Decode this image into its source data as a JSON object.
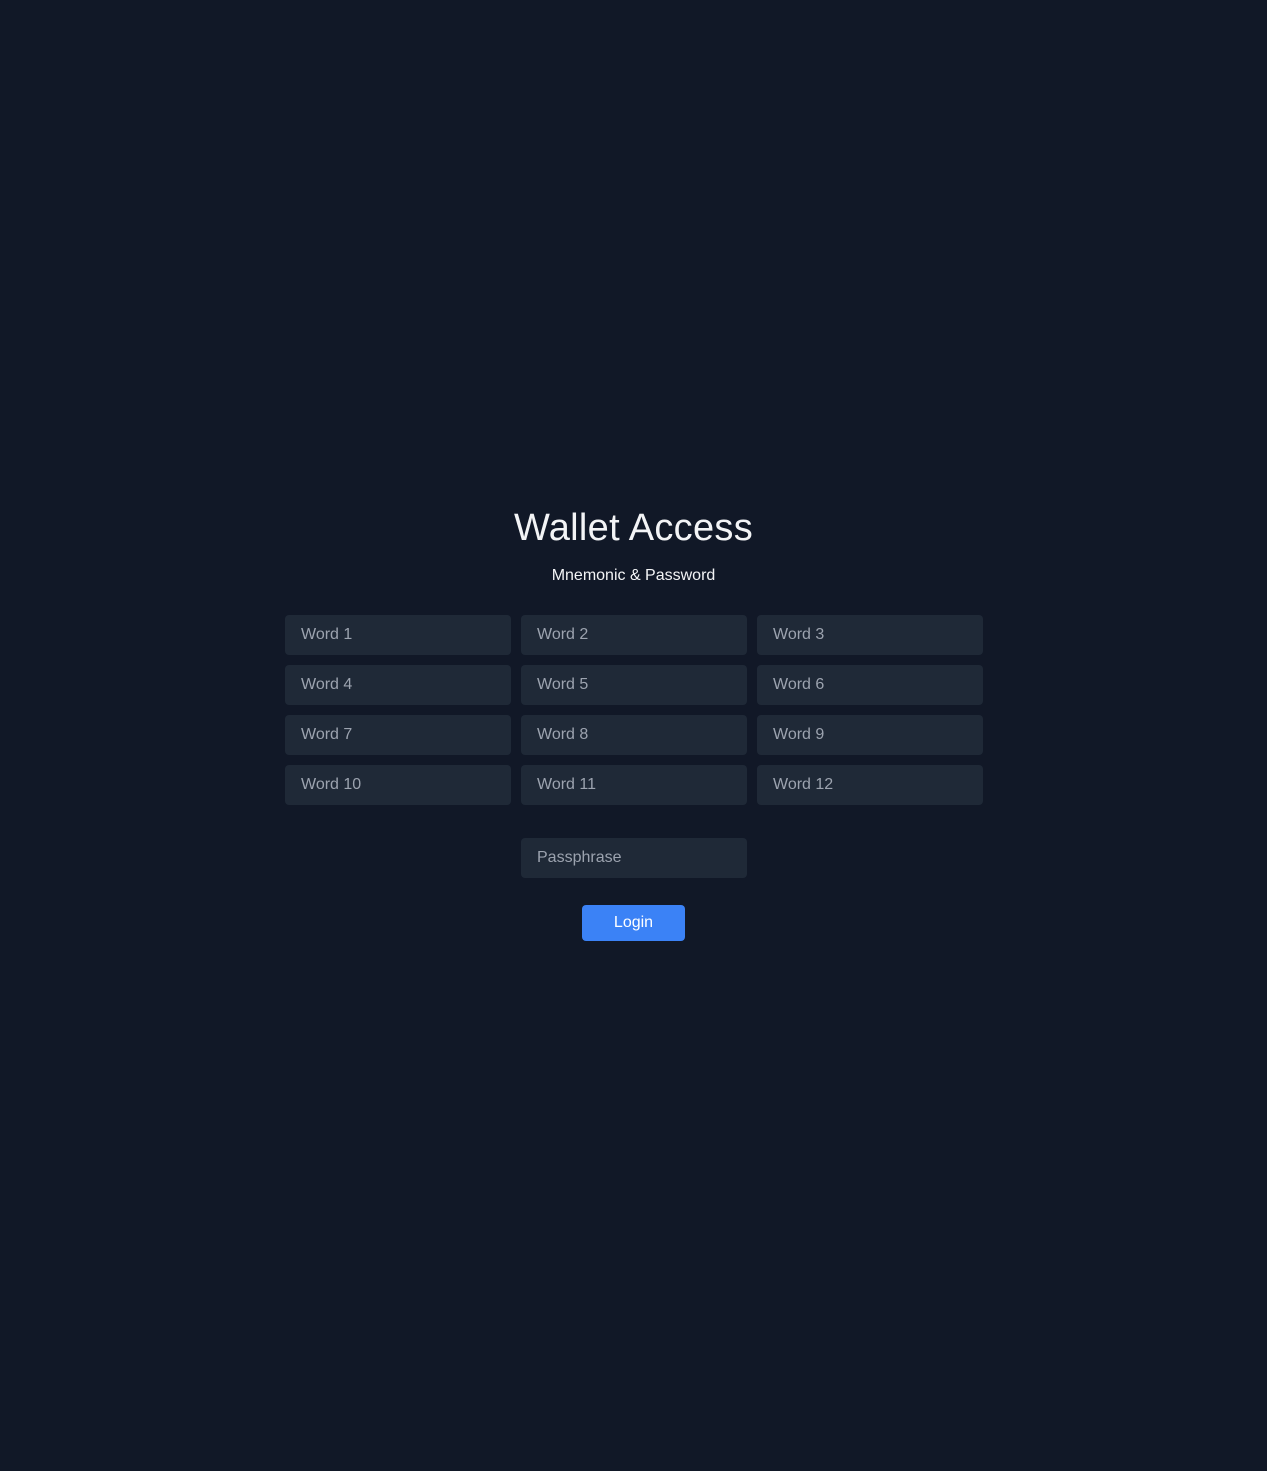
{
  "header": {
    "title": "Wallet Access",
    "subtitle": "Mnemonic & Password"
  },
  "mnemonic": {
    "words": [
      {
        "placeholder": "Word 1",
        "value": ""
      },
      {
        "placeholder": "Word 2",
        "value": ""
      },
      {
        "placeholder": "Word 3",
        "value": ""
      },
      {
        "placeholder": "Word 4",
        "value": ""
      },
      {
        "placeholder": "Word 5",
        "value": ""
      },
      {
        "placeholder": "Word 6",
        "value": ""
      },
      {
        "placeholder": "Word 7",
        "value": ""
      },
      {
        "placeholder": "Word 8",
        "value": ""
      },
      {
        "placeholder": "Word 9",
        "value": ""
      },
      {
        "placeholder": "Word 10",
        "value": ""
      },
      {
        "placeholder": "Word 11",
        "value": ""
      },
      {
        "placeholder": "Word 12",
        "value": ""
      }
    ]
  },
  "passphrase": {
    "placeholder": "Passphrase",
    "value": ""
  },
  "actions": {
    "login_label": "Login"
  },
  "colors": {
    "background": "#111827",
    "field_background": "#1f2937",
    "accent": "#3b82f6",
    "text": "#f3f4f6",
    "placeholder": "#9ca3af"
  }
}
